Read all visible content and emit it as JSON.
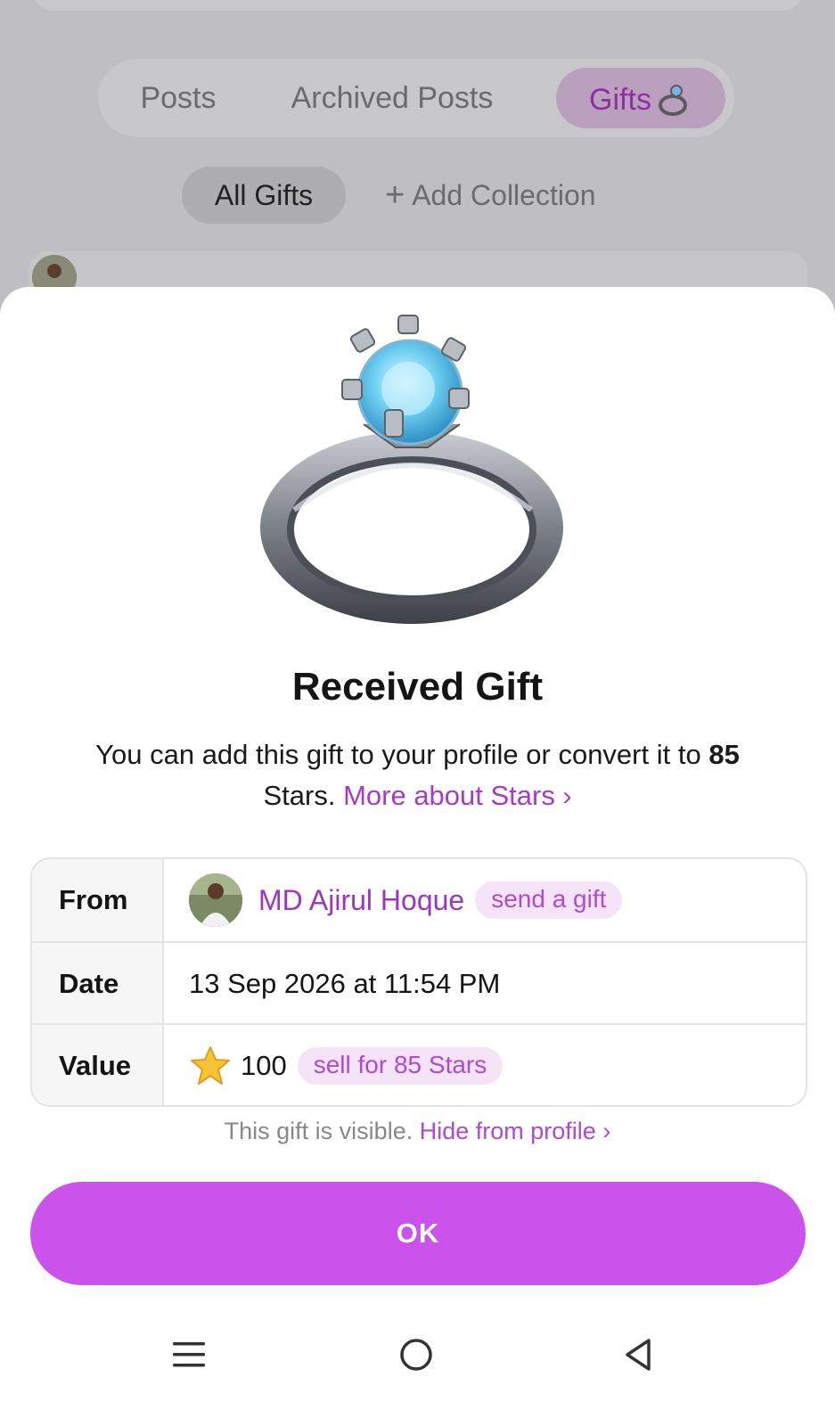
{
  "tabs": {
    "posts": "Posts",
    "archived": "Archived Posts",
    "gifts": "Gifts"
  },
  "collections": {
    "all": "All Gifts",
    "add": "Add Collection"
  },
  "gift": {
    "title": "Received Gift",
    "desc_part1": "You can add this gift to your profile or convert it to",
    "desc_stars": "85",
    "desc_part2": "Stars.",
    "desc_link": "More about Stars",
    "icon": "ring-icon"
  },
  "info": {
    "from_label": "From",
    "from_name": "MD Ajirul Hoque",
    "from_action": "send a gift",
    "date_label": "Date",
    "date_value": "13 Sep 2026 at 11:54 PM",
    "value_label": "Value",
    "value_amount": "100",
    "value_action": "sell for 85 Stars"
  },
  "visibility": {
    "text": "This gift is visible.",
    "link": "Hide from profile"
  },
  "ok_button": "OK",
  "nav": {
    "menu": "menu-icon",
    "home": "home-icon",
    "back": "back-icon"
  },
  "colors": {
    "accent": "#cc52ec",
    "link": "#a53cc6",
    "pill_bg": "#f5e4f7"
  }
}
